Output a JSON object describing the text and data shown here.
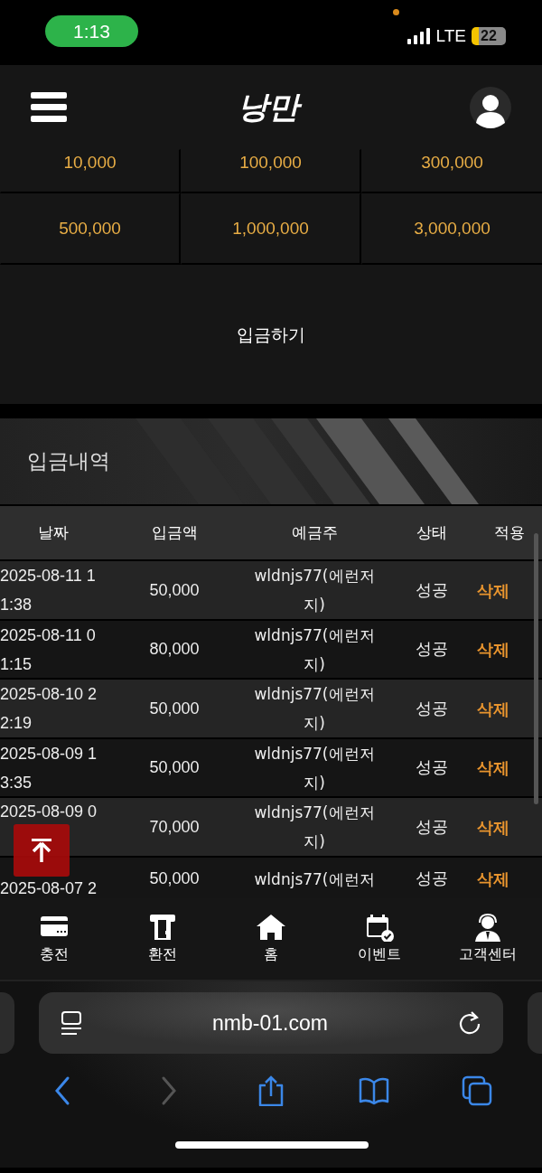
{
  "status_bar": {
    "time": "1:13",
    "network": "LTE",
    "battery": "22"
  },
  "header": {
    "logo": "낭만"
  },
  "amounts": [
    "10,000",
    "100,000",
    "300,000",
    "500,000",
    "1,000,000",
    "3,000,000"
  ],
  "deposit_button": "입금하기",
  "history": {
    "title": "입금내역",
    "columns": [
      "날짜",
      "입금액",
      "예금주",
      "상태",
      "적용"
    ],
    "rows": [
      {
        "date": "2025-08-11 11:38",
        "amount": "50,000",
        "depositor": "wldnjs77(에런저지)",
        "status": "성공",
        "action": "삭제"
      },
      {
        "date": "2025-08-11 01:15",
        "amount": "80,000",
        "depositor": "wldnjs77(에런저지)",
        "status": "성공",
        "action": "삭제"
      },
      {
        "date": "2025-08-10 22:19",
        "amount": "50,000",
        "depositor": "wldnjs77(에런저지)",
        "status": "성공",
        "action": "삭제"
      },
      {
        "date": "2025-08-09 13:35",
        "amount": "50,000",
        "depositor": "wldnjs77(에런저지)",
        "status": "성공",
        "action": "삭제"
      },
      {
        "date": "2025-08-09 0",
        "amount": "70,000",
        "depositor": "wldnjs77(에런저지)",
        "status": "성공",
        "action": "삭제"
      },
      {
        "date": "2025-08-07 2",
        "amount": "50,000",
        "depositor": "wldnjs77(에런저",
        "status": "성공",
        "action": "삭제"
      }
    ]
  },
  "bottom_nav": [
    {
      "kind": "card",
      "label": "충전"
    },
    {
      "kind": "atm",
      "label": "환전"
    },
    {
      "kind": "home",
      "label": "홈"
    },
    {
      "kind": "calendar",
      "label": "이벤트"
    },
    {
      "kind": "support",
      "label": "고객센터"
    }
  ],
  "browser": {
    "url": "nmb-01.com",
    "toolbar": [
      {
        "kind": "back",
        "disabled": false
      },
      {
        "kind": "forward",
        "disabled": true
      },
      {
        "kind": "share",
        "disabled": false
      },
      {
        "kind": "bookmarks",
        "disabled": false
      },
      {
        "kind": "tabs",
        "disabled": false
      }
    ]
  }
}
